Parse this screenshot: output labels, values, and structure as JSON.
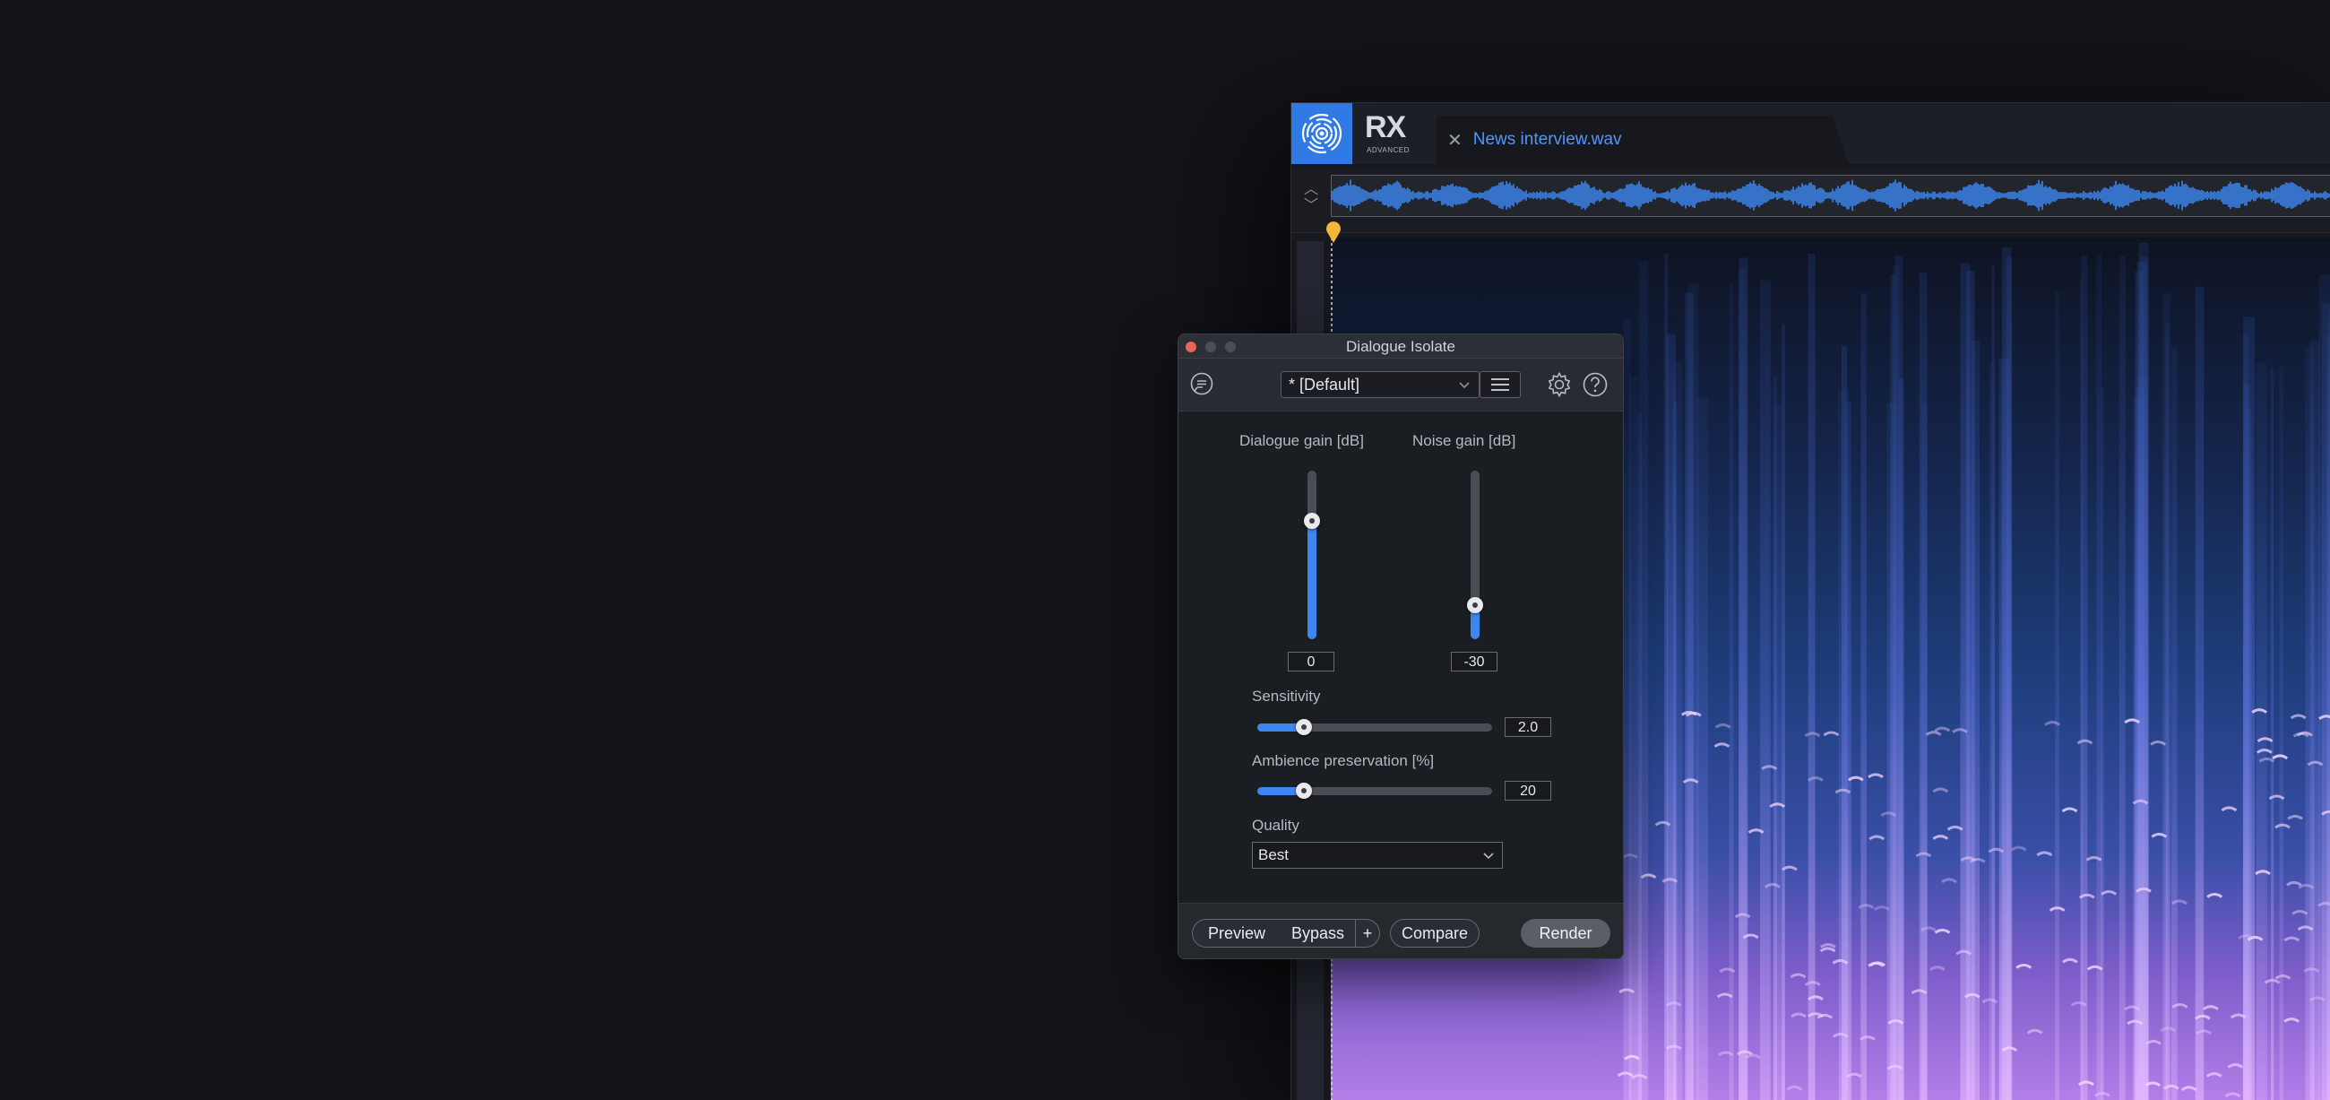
{
  "app": {
    "logo_text": "RX",
    "logo_sub": "ADVANCED",
    "tab_close_glyph": "✕",
    "tab_name": "News interview.wav",
    "accent_color": "#2f7ae5"
  },
  "overview": {
    "scroll_up_glyph": "︿",
    "scroll_down_glyph": "﹀"
  },
  "panel": {
    "title": "Dialogue Isolate",
    "preset": "* [Default]",
    "dialogue_gain": {
      "label": "Dialogue gain [dB]",
      "value": "0",
      "level": 0.7
    },
    "noise_gain": {
      "label": "Noise gain [dB]",
      "value": "-30",
      "level": 0.2
    },
    "sensitivity": {
      "label": "Sensitivity",
      "value": "2.0",
      "level": 0.2
    },
    "ambience": {
      "label": "Ambience preservation [%]",
      "value": "20",
      "level": 0.2
    },
    "quality": {
      "label": "Quality",
      "value": "Best"
    },
    "buttons": {
      "preview": "Preview",
      "bypass": "Bypass",
      "plus": "+",
      "compare": "Compare",
      "render": "Render"
    }
  },
  "icons": [
    "rx-logo-icon",
    "close-icon",
    "comment-icon",
    "chevron-down-icon",
    "menu-icon",
    "gear-icon",
    "help-icon",
    "playhead-marker-icon"
  ]
}
